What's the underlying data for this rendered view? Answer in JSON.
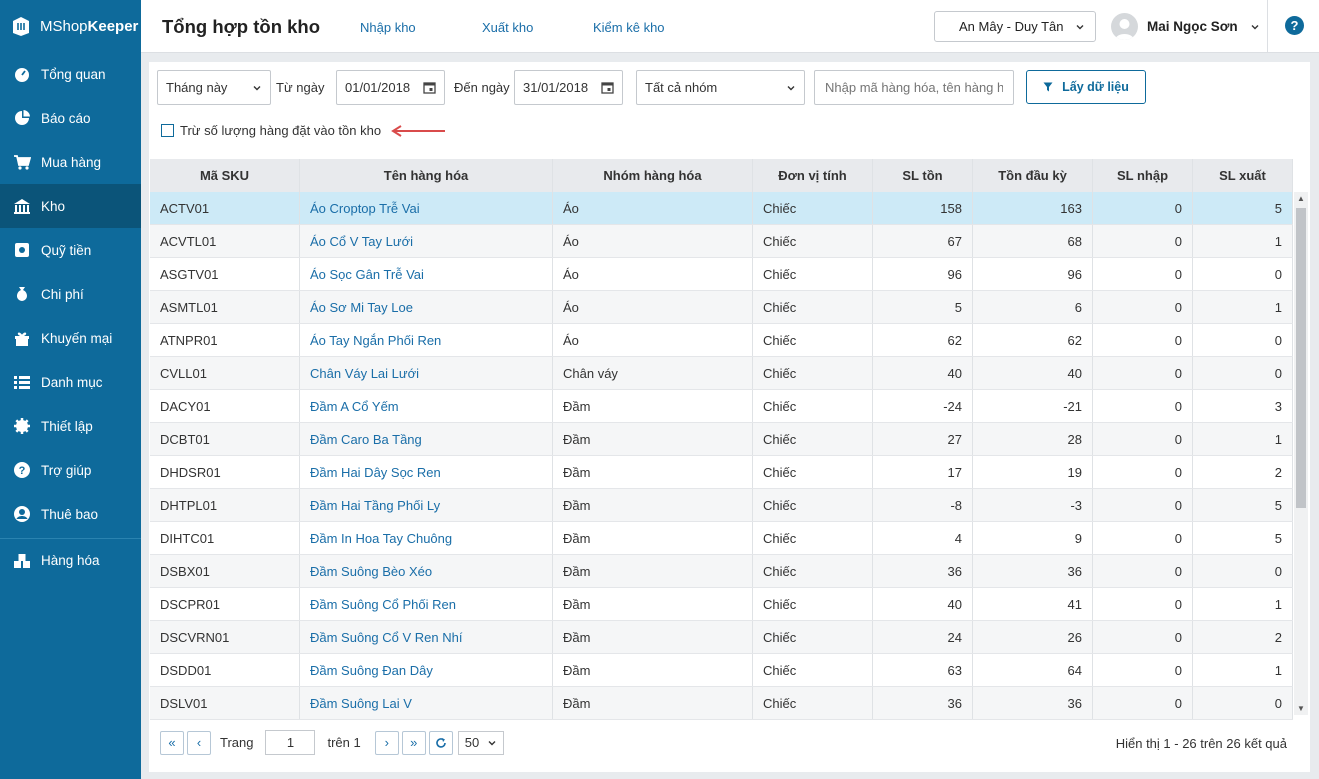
{
  "app": {
    "brand_light": "MShop",
    "brand_bold": "Keeper"
  },
  "sidebar": {
    "items": [
      {
        "label": "Tổng quan",
        "icon": "dashboard-icon"
      },
      {
        "label": "Báo cáo",
        "icon": "pie-chart-icon"
      },
      {
        "label": "Mua hàng",
        "icon": "cart-icon"
      },
      {
        "label": "Kho",
        "icon": "warehouse-icon"
      },
      {
        "label": "Quỹ tiền",
        "icon": "safe-icon"
      },
      {
        "label": "Chi phí",
        "icon": "money-bag-icon"
      },
      {
        "label": "Khuyến mại",
        "icon": "gift-icon"
      },
      {
        "label": "Danh mục",
        "icon": "list-icon"
      },
      {
        "label": "Thiết lập",
        "icon": "gear-icon"
      },
      {
        "label": "Trợ giúp",
        "icon": "help-icon"
      },
      {
        "label": "Thuê bao",
        "icon": "user-icon"
      },
      {
        "label": "Hàng hóa",
        "icon": "cubes-icon"
      }
    ]
  },
  "header": {
    "title": "Tổng hợp tồn kho",
    "links": [
      "Nhập kho",
      "Xuất kho",
      "Kiểm kê kho"
    ],
    "store": "An Mây - Duy Tân",
    "user": "Mai Ngọc Sơn",
    "help": "?"
  },
  "filters": {
    "period": "Tháng này",
    "from_label": "Từ ngày",
    "from_date": "01/01/2018",
    "to_label": "Đến ngày",
    "to_date": "31/01/2018",
    "group": "Tất cả nhóm",
    "search_placeholder": "Nhập mã hàng hóa, tên hàng hóa",
    "get_data_label": "Lấy dữ liệu",
    "checkbox_label": "Trừ số lượng hàng đặt vào tồn kho"
  },
  "table": {
    "headers": [
      "Mã SKU",
      "Tên hàng hóa",
      "Nhóm hàng hóa",
      "Đơn vị tính",
      "SL tồn",
      "Tồn đầu kỳ",
      "SL nhập",
      "SL xuất"
    ],
    "rows": [
      [
        "ACTV01",
        "Áo Croptop Trễ Vai",
        "Áo",
        "Chiếc",
        "158",
        "163",
        "0",
        "5"
      ],
      [
        "ACVTL01",
        "Áo Cổ V Tay Lưới",
        "Áo",
        "Chiếc",
        "67",
        "68",
        "0",
        "1"
      ],
      [
        "ASGTV01",
        "Áo Sọc Gân Trễ Vai",
        "Áo",
        "Chiếc",
        "96",
        "96",
        "0",
        "0"
      ],
      [
        "ASMTL01",
        "Áo Sơ Mi Tay Loe",
        "Áo",
        "Chiếc",
        "5",
        "6",
        "0",
        "1"
      ],
      [
        "ATNPR01",
        "Áo Tay Ngắn Phối Ren",
        "Áo",
        "Chiếc",
        "62",
        "62",
        "0",
        "0"
      ],
      [
        "CVLL01",
        "Chân Váy Lai Lưới",
        "Chân váy",
        "Chiếc",
        "40",
        "40",
        "0",
        "0"
      ],
      [
        "DACY01",
        "Đầm A Cổ Yếm",
        "Đầm",
        "Chiếc",
        "-24",
        "-21",
        "0",
        "3"
      ],
      [
        "DCBT01",
        "Đầm Caro Ba Tầng",
        "Đầm",
        "Chiếc",
        "27",
        "28",
        "0",
        "1"
      ],
      [
        "DHDSR01",
        "Đầm Hai Dây Sọc Ren",
        "Đầm",
        "Chiếc",
        "17",
        "19",
        "0",
        "2"
      ],
      [
        "DHTPL01",
        "Đầm Hai Tầng Phối Ly",
        "Đầm",
        "Chiếc",
        "-8",
        "-3",
        "0",
        "5"
      ],
      [
        "DIHTC01",
        "Đầm In Hoa Tay Chuông",
        "Đầm",
        "Chiếc",
        "4",
        "9",
        "0",
        "5"
      ],
      [
        "DSBX01",
        "Đầm Suông Bèo Xéo",
        "Đầm",
        "Chiếc",
        "36",
        "36",
        "0",
        "0"
      ],
      [
        "DSCPR01",
        "Đầm Suông Cổ Phối Ren",
        "Đầm",
        "Chiếc",
        "40",
        "41",
        "0",
        "1"
      ],
      [
        "DSCVRN01",
        "Đầm Suông Cổ V Ren Nhí",
        "Đầm",
        "Chiếc",
        "24",
        "26",
        "0",
        "2"
      ],
      [
        "DSDD01",
        "Đầm Suông Đan Dây",
        "Đầm",
        "Chiếc",
        "63",
        "64",
        "0",
        "1"
      ],
      [
        "DSLV01",
        "Đầm Suông Lai V",
        "Đầm",
        "Chiếc",
        "36",
        "36",
        "0",
        "0"
      ]
    ]
  },
  "pager": {
    "page_label": "Trang",
    "page": "1",
    "of_label": "trên 1",
    "page_size": "50",
    "result_text": "Hiển thị 1 - 26 trên 26 kết quả"
  }
}
